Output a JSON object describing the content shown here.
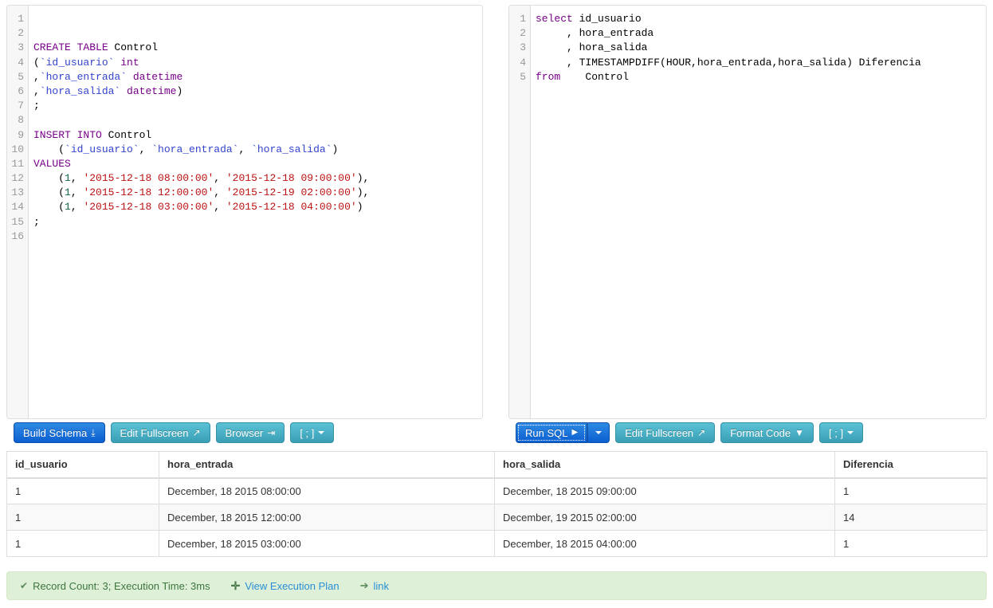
{
  "schema_editor": {
    "total_lines": 16,
    "lines": [
      [],
      [],
      [
        {
          "t": "kw",
          "v": "CREATE TABLE"
        },
        {
          "t": "def",
          "v": " Control"
        }
      ],
      [
        {
          "t": "def",
          "v": "("
        },
        {
          "t": "var",
          "v": "`id_usuario`"
        },
        {
          "t": "def",
          "v": " "
        },
        {
          "t": "kw",
          "v": "int"
        }
      ],
      [
        {
          "t": "def",
          "v": ","
        },
        {
          "t": "var",
          "v": "`hora_entrada`"
        },
        {
          "t": "def",
          "v": " "
        },
        {
          "t": "kw",
          "v": "datetime"
        }
      ],
      [
        {
          "t": "def",
          "v": ","
        },
        {
          "t": "var",
          "v": "`hora_salida`"
        },
        {
          "t": "def",
          "v": " "
        },
        {
          "t": "kw",
          "v": "datetime"
        },
        {
          "t": "def",
          "v": ")"
        }
      ],
      [
        {
          "t": "def",
          "v": ";"
        }
      ],
      [],
      [
        {
          "t": "kw",
          "v": "INSERT INTO"
        },
        {
          "t": "def",
          "v": " Control"
        }
      ],
      [
        {
          "t": "def",
          "v": "    ("
        },
        {
          "t": "var",
          "v": "`id_usuario`"
        },
        {
          "t": "def",
          "v": ", "
        },
        {
          "t": "var",
          "v": "`hora_entrada`"
        },
        {
          "t": "def",
          "v": ", "
        },
        {
          "t": "var",
          "v": "`hora_salida`"
        },
        {
          "t": "def",
          "v": ")"
        }
      ],
      [
        {
          "t": "kw",
          "v": "VALUES"
        }
      ],
      [
        {
          "t": "def",
          "v": "    ("
        },
        {
          "t": "num",
          "v": "1"
        },
        {
          "t": "def",
          "v": ", "
        },
        {
          "t": "str",
          "v": "'2015-12-18 08:00:00'"
        },
        {
          "t": "def",
          "v": ", "
        },
        {
          "t": "str",
          "v": "'2015-12-18 09:00:00'"
        },
        {
          "t": "def",
          "v": "),"
        }
      ],
      [
        {
          "t": "def",
          "v": "    ("
        },
        {
          "t": "num",
          "v": "1"
        },
        {
          "t": "def",
          "v": ", "
        },
        {
          "t": "str",
          "v": "'2015-12-18 12:00:00'"
        },
        {
          "t": "def",
          "v": ", "
        },
        {
          "t": "str",
          "v": "'2015-12-19 02:00:00'"
        },
        {
          "t": "def",
          "v": "),"
        }
      ],
      [
        {
          "t": "def",
          "v": "    ("
        },
        {
          "t": "num",
          "v": "1"
        },
        {
          "t": "def",
          "v": ", "
        },
        {
          "t": "str",
          "v": "'2015-12-18 03:00:00'"
        },
        {
          "t": "def",
          "v": ", "
        },
        {
          "t": "str",
          "v": "'2015-12-18 04:00:00'"
        },
        {
          "t": "def",
          "v": ")"
        }
      ],
      [
        {
          "t": "def",
          "v": ";"
        }
      ],
      []
    ]
  },
  "query_editor": {
    "total_lines": 5,
    "lines": [
      [
        {
          "t": "kw",
          "v": "select"
        },
        {
          "t": "def",
          "v": " id_usuario"
        }
      ],
      [
        {
          "t": "def",
          "v": "     , hora_entrada"
        }
      ],
      [
        {
          "t": "def",
          "v": "     , hora_salida"
        }
      ],
      [
        {
          "t": "def",
          "v": "     , TIMESTAMPDIFF(HOUR,hora_entrada,hora_salida) Diferencia"
        }
      ],
      [
        {
          "t": "kw",
          "v": "from"
        },
        {
          "t": "def",
          "v": "    Control"
        }
      ]
    ]
  },
  "schema_toolbar": {
    "build_schema": "Build Schema",
    "build_schema_icon": "download-icon",
    "edit_fullscreen": "Edit Fullscreen",
    "edit_fullscreen_icon": "expand-arrows-icon",
    "browser": "Browser",
    "browser_icon": "indent-icon",
    "delimiter": "[ ; ]",
    "delimiter_icon": "chevron-down-icon"
  },
  "query_toolbar": {
    "run_sql": "Run SQL",
    "run_sql_icon": "play-icon",
    "run_sql_dropdown_icon": "chevron-down-icon",
    "edit_fullscreen": "Edit Fullscreen",
    "edit_fullscreen_icon": "expand-arrows-icon",
    "format_code": "Format Code",
    "format_code_icon": "filter-icon",
    "delimiter": "[ ; ]",
    "delimiter_icon": "chevron-down-icon"
  },
  "results": {
    "columns": [
      "id_usuario",
      "hora_entrada",
      "hora_salida",
      "Diferencia"
    ],
    "rows": [
      [
        "1",
        "December, 18 2015 08:00:00",
        "December, 18 2015 09:00:00",
        "1"
      ],
      [
        "1",
        "December, 18 2015 12:00:00",
        "December, 19 2015 02:00:00",
        "14"
      ],
      [
        "1",
        "December, 18 2015 03:00:00",
        "December, 18 2015 04:00:00",
        "1"
      ]
    ]
  },
  "status": {
    "check_icon": "check-icon",
    "summary": "Record Count: 3; Execution Time: 3ms",
    "plus_icon": "plus-icon",
    "execution_plan_label": "View Execution Plan",
    "arrow_icon": "share-arrow-icon",
    "link_label": "link"
  },
  "colors": {
    "primary_button": "#0b5fd0",
    "info_button": "#3a9fb5",
    "status_bg": "#dff0d8",
    "status_text": "#3c763d",
    "link": "#2a8fd4",
    "keyword": "#770088",
    "variable": "#3344cc",
    "string": "#bb1111",
    "number": "#116644"
  }
}
